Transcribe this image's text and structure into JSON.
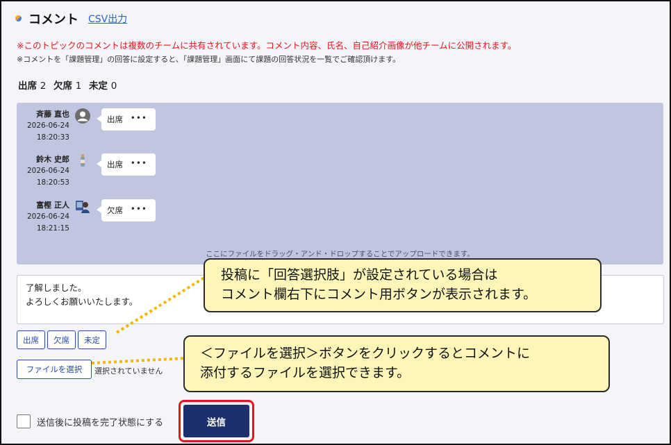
{
  "header": {
    "title": "コメント",
    "csv_label": "CSV出力"
  },
  "notices": {
    "red": "※このトピックのコメントは複数のチームに共有されています。コメント内容、氏名、自己紹介画像が他チームに公開されます。",
    "gray": "※コメントを「課題管理」の回答に設定すると、「課題管理」画面にて課題の回答状況を一覧でご確認頂けます。"
  },
  "summary": {
    "present_label": "出席",
    "present_count": "2",
    "absent_label": "欠席",
    "absent_count": "1",
    "undecided_label": "未定",
    "undecided_count": "0"
  },
  "comments": [
    {
      "name": "斉藤 直也",
      "date": "2026-06-24",
      "time": "18:20:33",
      "answer": "出席",
      "more": "•••"
    },
    {
      "name": "鈴木 史郎",
      "date": "2026-06-24",
      "time": "18:20:53",
      "answer": "出席",
      "more": "•••"
    },
    {
      "name": "富樫 正人",
      "date": "2026-06-24",
      "time": "18:21:15",
      "answer": "欠席",
      "more": "•••"
    }
  ],
  "drop_hint": "ここにファイルをドラッグ・アンド・ドロップすることでアップロードできます。",
  "textarea_value": "了解しました。\nよろしくお願いいたします。",
  "answer_options": [
    "出席",
    "欠席",
    "未定"
  ],
  "file": {
    "button_label": "ファイルを選択",
    "status": "選択されていません"
  },
  "complete_checkbox_label": "送信後に投稿を完了状態にする",
  "send_label": "送信",
  "callouts": {
    "first_line1": "投稿に「回答選択肢」が設定されている場合は",
    "first_line2": "コメント欄右下にコメント用ボタンが表示されます。",
    "second_line1": "＜ファイルを選択＞ボタンをクリックするとコメントに",
    "second_line2": "添付するファイルを選択できます。"
  },
  "colors": {
    "warning_red": "#e8141c",
    "link_blue": "#2b5fd9",
    "button_navy": "#1e2f6e",
    "drop_area": "#c1c6e0",
    "callout_yellow": "#fdf6b8",
    "connector_orange": "#f5b800"
  }
}
